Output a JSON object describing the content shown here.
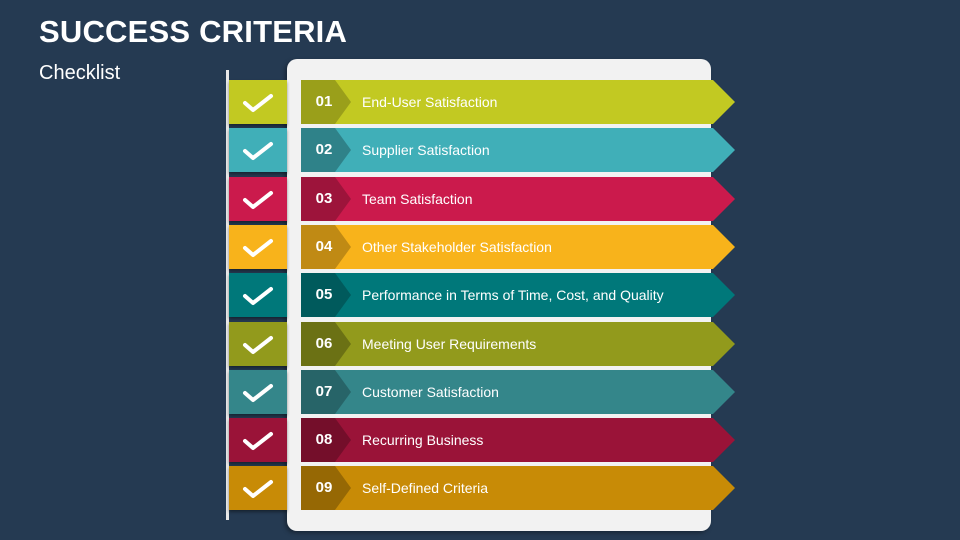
{
  "header": {
    "title": "SUCCESS CRITERIA",
    "subtitle": "Checklist"
  },
  "checklist": {
    "items": [
      {
        "number": "01",
        "label": "End-User Satisfaction",
        "checked": true,
        "color": "#c2c922",
        "dark": "#9a9f1a"
      },
      {
        "number": "02",
        "label": "Supplier Satisfaction",
        "checked": true,
        "color": "#40afb8",
        "dark": "#2f8289"
      },
      {
        "number": "03",
        "label": "Team Satisfaction",
        "checked": true,
        "color": "#cb1a4c",
        "dark": "#9d143b"
      },
      {
        "number": "04",
        "label": "Other Stakeholder Satisfaction",
        "checked": true,
        "color": "#f8b31b",
        "dark": "#c08a14"
      },
      {
        "number": "05",
        "label": "Performance in Terms of Time, Cost, and Quality",
        "checked": true,
        "color": "#00787a",
        "dark": "#005a5c"
      },
      {
        "number": "06",
        "label": "Meeting User Requirements",
        "checked": true,
        "color": "#929a1c",
        "dark": "#6b7114"
      },
      {
        "number": "07",
        "label": "Customer Satisfaction",
        "checked": true,
        "color": "#34868a",
        "dark": "#276468"
      },
      {
        "number": "08",
        "label": "Recurring Business",
        "checked": true,
        "color": "#9a1338",
        "dark": "#740e2a"
      },
      {
        "number": "09",
        "label": "Self-Defined Criteria",
        "checked": true,
        "color": "#c88b06",
        "dark": "#966804"
      }
    ]
  }
}
